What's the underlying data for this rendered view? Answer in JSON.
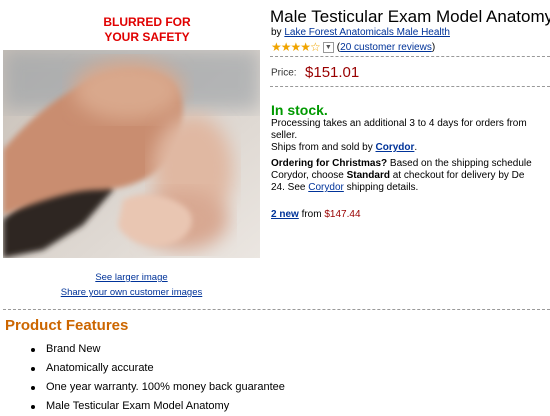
{
  "overlay": {
    "blur_notice_line1": "BLURRED FOR",
    "blur_notice_line2": "YOUR SAFETY"
  },
  "product": {
    "title": "Male Testicular Exam Model Anatomy",
    "by_prefix": "by",
    "brand": "Lake Forest Anatomicals Male Health",
    "rating_stars": "★★★★☆",
    "reviews_link": "20 customer reviews",
    "price_label": "Price:",
    "price": "$151.01"
  },
  "image_links": {
    "see_larger": "See larger image",
    "share_images": "Share your own customer images"
  },
  "availability": {
    "status": "In stock.",
    "processing_line1": "Processing takes an additional 3 to 4 days for orders from",
    "processing_line2": "seller.",
    "ships_from_prefix": "Ships from and sold by",
    "seller": "Corydor",
    "ships_from_suffix": "."
  },
  "christmas": {
    "heading": "Ordering for Christmas?",
    "line1_rest": "Based on the shipping schedule",
    "line2_prefix": "Corydor, choose",
    "line2_bold": "Standard",
    "line2_rest": "at checkout for delivery by De",
    "line3_prefix": "24. See",
    "line3_link": "Corydor",
    "line3_rest": "shipping details."
  },
  "offers": {
    "new_link": "2 new",
    "from_text": "from",
    "new_price": "$147.44"
  },
  "features": {
    "title": "Product Features",
    "items": [
      "Brand New",
      "Anatomically accurate",
      "One year warranty. 100% money back guarantee",
      "Male Testicular Exam Model Anatomy"
    ]
  }
}
